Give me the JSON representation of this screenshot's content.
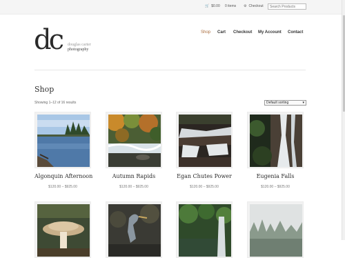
{
  "topbar": {
    "cart_amount": "$0.00",
    "cart_items": "0 items",
    "checkout": "Checkout",
    "search_placeholder": "Search Products"
  },
  "brand": {
    "logo": "dc",
    "name": "douglas carter",
    "tagline": "photography"
  },
  "nav": [
    "Shop",
    "Cart",
    "Checkout",
    "My Account",
    "Contact"
  ],
  "page": {
    "title": "Shop",
    "result_count": "Showing 1–12 of 16 results",
    "sort_selected": "Default sorting"
  },
  "products": [
    {
      "name": "Algonquin Afternoon",
      "price": "$120.00 – $925.00"
    },
    {
      "name": "Autumn Rapids",
      "price": "$120.00 – $925.00"
    },
    {
      "name": "Egan Chutes Power",
      "price": "$120.00 – $925.00"
    },
    {
      "name": "Eugenia Falls",
      "price": "$120.00 – $925.00"
    },
    {
      "name": "",
      "price": ""
    },
    {
      "name": "",
      "price": ""
    },
    {
      "name": "",
      "price": ""
    },
    {
      "name": "",
      "price": ""
    }
  ],
  "colors": {
    "accent": "#a86a3a",
    "text": "#333333"
  }
}
